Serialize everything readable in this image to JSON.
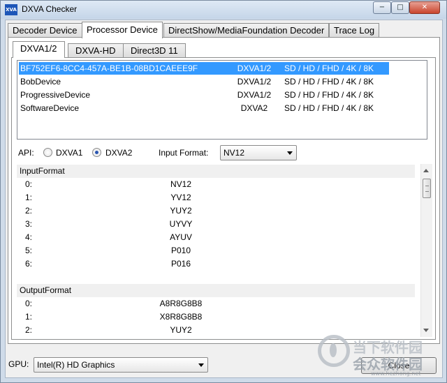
{
  "window": {
    "icon_text": "XVA",
    "title": "DXVA Checker"
  },
  "main_tabs": [
    {
      "label": "Decoder Device"
    },
    {
      "label": "Processor Device"
    },
    {
      "label": "DirectShow/MediaFoundation Decoder"
    },
    {
      "label": "Trace Log"
    }
  ],
  "sub_tabs": [
    {
      "label": "DXVA1/2"
    },
    {
      "label": "DXVA-HD"
    },
    {
      "label": "Direct3D 11"
    }
  ],
  "devices": [
    {
      "name": "BF752EF6-8CC4-457A-BE1B-08BD1CAEEE9F",
      "api": "DXVA1/2",
      "resolutions": "SD / HD / FHD / 4K / 8K",
      "selected": true
    },
    {
      "name": "BobDevice",
      "api": "DXVA1/2",
      "resolutions": "SD / HD / FHD / 4K / 8K"
    },
    {
      "name": "ProgressiveDevice",
      "api": "DXVA1/2",
      "resolutions": "SD / HD / FHD / 4K / 8K"
    },
    {
      "name": "SoftwareDevice",
      "api": "DXVA2",
      "resolutions": "SD / HD / FHD / 4K / 8K"
    }
  ],
  "api_selector": {
    "label": "API:",
    "option1": "DXVA1",
    "option2": "DXVA2",
    "selected": "DXVA2"
  },
  "input_format": {
    "label": "Input Format:",
    "value": "NV12"
  },
  "properties": {
    "input_header": "InputFormat",
    "input_rows": [
      {
        "index": "0:",
        "value": "NV12"
      },
      {
        "index": "1:",
        "value": "YV12"
      },
      {
        "index": "2:",
        "value": "YUY2"
      },
      {
        "index": "3:",
        "value": "UYVY"
      },
      {
        "index": "4:",
        "value": "AYUV"
      },
      {
        "index": "5:",
        "value": "P010"
      },
      {
        "index": "6:",
        "value": "P016"
      }
    ],
    "output_header": "OutputFormat",
    "output_rows": [
      {
        "index": "0:",
        "value": "A8R8G8B8"
      },
      {
        "index": "1:",
        "value": "X8R8G8B8"
      },
      {
        "index": "2:",
        "value": "YUY2"
      }
    ]
  },
  "gpu": {
    "label": "GPU:",
    "value": "Intel(R) HD Graphics"
  },
  "close_label": "Close",
  "watermark": {
    "line1": "当下软件园",
    "line2": "会众软件园",
    "url": "www.hezhong.net"
  }
}
